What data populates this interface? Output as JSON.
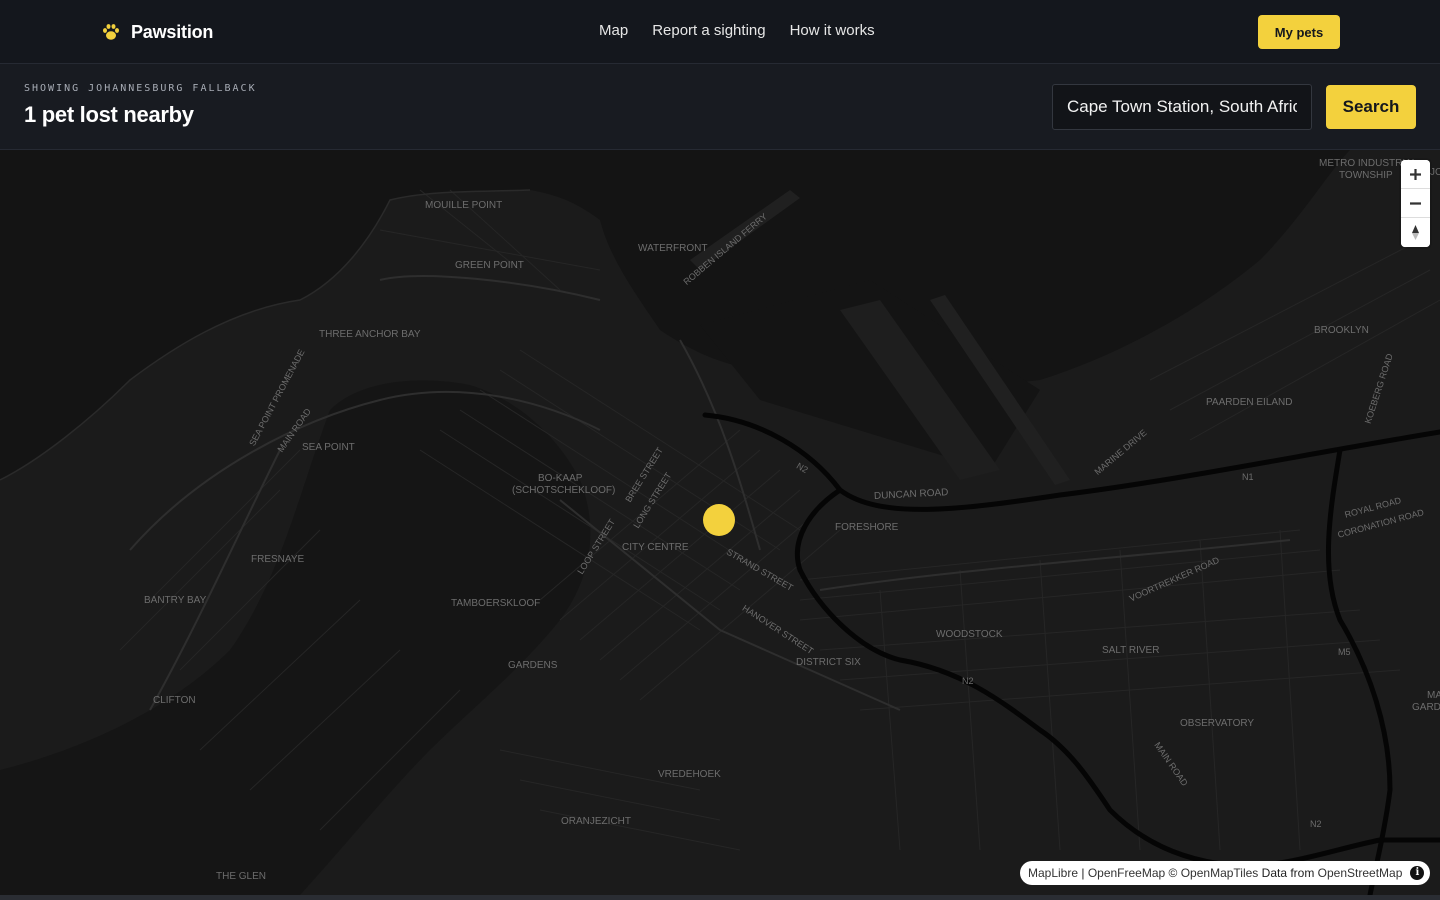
{
  "brand": {
    "name": "Pawsition",
    "logo_icon": "paw-icon",
    "accent": "#f3d13d"
  },
  "nav": {
    "links": [
      {
        "label": "Map"
      },
      {
        "label": "Report a sighting"
      },
      {
        "label": "How it works"
      }
    ],
    "my_pets_label": "My pets"
  },
  "results": {
    "eyebrow": "SHOWING JOHANNESBURG FALLBACK",
    "title": "1 pet lost nearby"
  },
  "search": {
    "value": "Cape Town Station, South Africa",
    "button_label": "Search"
  },
  "map": {
    "labels": {
      "mouille_point": "MOUILLE POINT",
      "green_point": "GREEN POINT",
      "waterfront": "WATERFRONT",
      "robben_island_ferry": "ROBBEN ISLAND FERRY",
      "three_anchor_bay": "THREE ANCHOR BAY",
      "sea_point_promenade": "SEA POINT PROMENADE",
      "main_road_west": "MAIN ROAD",
      "sea_point": "SEA POINT",
      "bo_kaap": "BO-KAAP",
      "schotschekloof": "(SCHOTSCHEKLOOF)",
      "bree_street": "BREE STREET",
      "long_street": "LONG STREET",
      "loop_street": "LOOP STREET",
      "city_centre": "CITY CENTRE",
      "fresnaye": "FRESNAYE",
      "bantry_bay": "BANTRY BAY",
      "tamboerskloof": "TAMBOERSKLOOF",
      "gardens": "GARDENS",
      "clifton": "CLIFTON",
      "vredehoek": "VREDEHOEK",
      "oranjezicht": "ORANJEZICHT",
      "the_glen": "THE GLEN",
      "n2_north": "N2",
      "duncan_road": "DUNCAN ROAD",
      "foreshore": "FORESHORE",
      "strand_street": "STRAND STREET",
      "hanover_street": "HANOVER STREET",
      "district_six": "DISTRICT SIX",
      "woodstock": "WOODSTOCK",
      "n2_south": "N2",
      "salt_river": "SALT RIVER",
      "observatory": "OBSERVATORY",
      "main_road_east": "MAIN ROAD",
      "voortrekker_road": "VOORTREKKER ROAD",
      "marine_drive": "MARINE DRIVE",
      "paarden_eiland": "PAARDEN EILAND",
      "n1": "N1",
      "brooklyn": "BROOKLYN",
      "metro_industrial": "METRO INDUSTRIAL",
      "township": "TOWNSHIP",
      "koeberg_road": "KOEBERG ROAD",
      "royal_road": "ROYAL ROAD",
      "coronation_road": "CORONATION ROAD",
      "m5": "M5",
      "n2_east": "N2",
      "mar_cut": "MA",
      "gard_cut": "GARD",
      "jo_cut": "JC"
    },
    "controls": {
      "zoom_in_icon": "plus-icon",
      "zoom_out_icon": "minus-icon",
      "compass_icon": "compass-icon"
    },
    "markers": [
      {
        "type": "lost-pet",
        "color": "#f3d13d"
      }
    ],
    "attribution": {
      "maplibre": "MapLibre",
      "sep": " | ",
      "openfreemap": "OpenFreeMap",
      "copy": " © ",
      "openmaptiles": "OpenMapTiles",
      "data_from": " Data from ",
      "openstreetmap": "OpenStreetMap",
      "info_icon": "info-icon"
    }
  }
}
